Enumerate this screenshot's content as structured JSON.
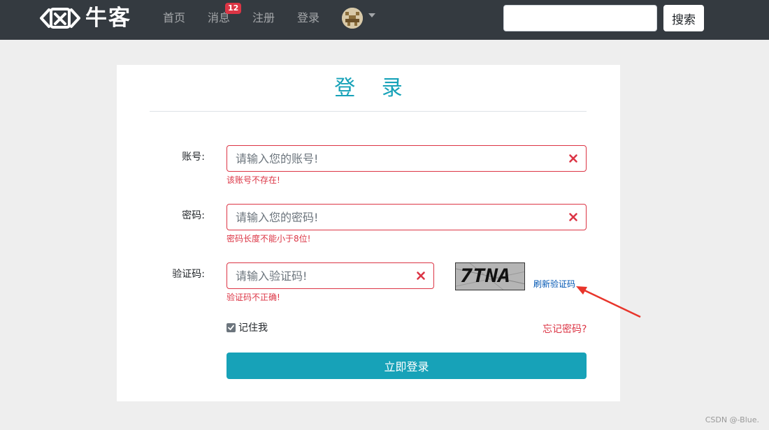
{
  "navbar": {
    "logo_text": "牛客",
    "links": {
      "home": "首页",
      "messages": "消息",
      "register": "注册",
      "login": "登录"
    },
    "message_badge": "12",
    "search": {
      "placeholder": "",
      "value": "",
      "button_label": "搜索"
    }
  },
  "login_form": {
    "title": "登 录",
    "account": {
      "label": "账号:",
      "placeholder": "请输入您的账号!",
      "value": "",
      "error": "该账号不存在!"
    },
    "password": {
      "label": "密码:",
      "placeholder": "请输入您的密码!",
      "value": "",
      "error": "密码长度不能小于8位!"
    },
    "captcha": {
      "label": "验证码:",
      "placeholder": "请输入验证码!",
      "value": "",
      "error": "验证码不正确!",
      "image_text": "7TNA",
      "refresh_label": "刷新验证码"
    },
    "remember_me": {
      "label": "记住我",
      "checked": true
    },
    "forgot_password": "忘记密码?",
    "submit_label": "立即登录"
  },
  "watermark": "CSDN @-Blue.",
  "colors": {
    "navbar_bg": "#343a40",
    "accent": "#17a2b8",
    "error": "#dc3545",
    "annotation_arrow": "#e8352b"
  },
  "icons": {
    "clear": "close-icon",
    "check": "check-icon",
    "dropdown": "chevron-down-icon"
  }
}
